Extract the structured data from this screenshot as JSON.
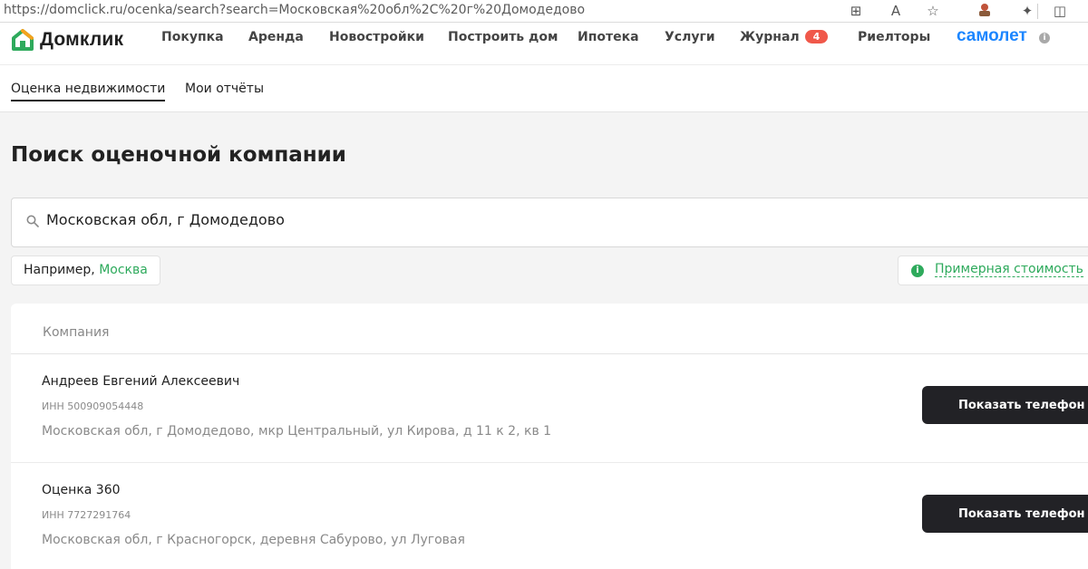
{
  "browser": {
    "url": "https://domclick.ru/ocenka/search?search=Московская%20обл%2С%20г%20Домодедово",
    "icons": [
      "grid-plus-icon",
      "read-aloud-icon",
      "star-icon",
      "profile-icon",
      "extensions-icon",
      "split-screen-icon"
    ]
  },
  "header": {
    "logo_text": "Домклик",
    "nav": [
      {
        "label": "Покупка"
      },
      {
        "label": "Аренда"
      },
      {
        "label": "Новостройки"
      },
      {
        "label": "Построить дом"
      },
      {
        "label": "Ипотека"
      },
      {
        "label": "Услуги"
      },
      {
        "label": "Журнал",
        "badge": "4"
      },
      {
        "label": "Риелторы"
      }
    ],
    "partner": "самолет",
    "partner_info": "i"
  },
  "subnav": {
    "items": [
      {
        "label": "Оценка недвижимости",
        "active": true
      },
      {
        "label": "Мои отчёты",
        "active": false
      }
    ]
  },
  "main": {
    "title": "Поиск оценочной компании",
    "search_value": "Московская обл, г Домодедово",
    "example_prefix": "Например, ",
    "example_city": "Москва",
    "cost_info": "i",
    "cost_link": "Примерная стоимость"
  },
  "table": {
    "column_header": "Компания",
    "rows": [
      {
        "name": "Андреев Евгений Алексеевич",
        "inn": "ИНН 500909054448",
        "address": "Московская обл, г Домодедово, мкр Центральный, ул Кирова, д 11 к 2, кв 1",
        "button": "Показать телефон"
      },
      {
        "name": "Оценка 360",
        "inn": "ИНН 7727291764",
        "address": "Московская обл, г Красногорск, деревня Сабурово, ул Луговая",
        "button": "Показать телефон"
      }
    ]
  },
  "colors": {
    "brand_green": "#2eaa5c",
    "button_dark": "#222226",
    "badge_red": "#f0584a",
    "partner_blue": "#1c86ff"
  }
}
